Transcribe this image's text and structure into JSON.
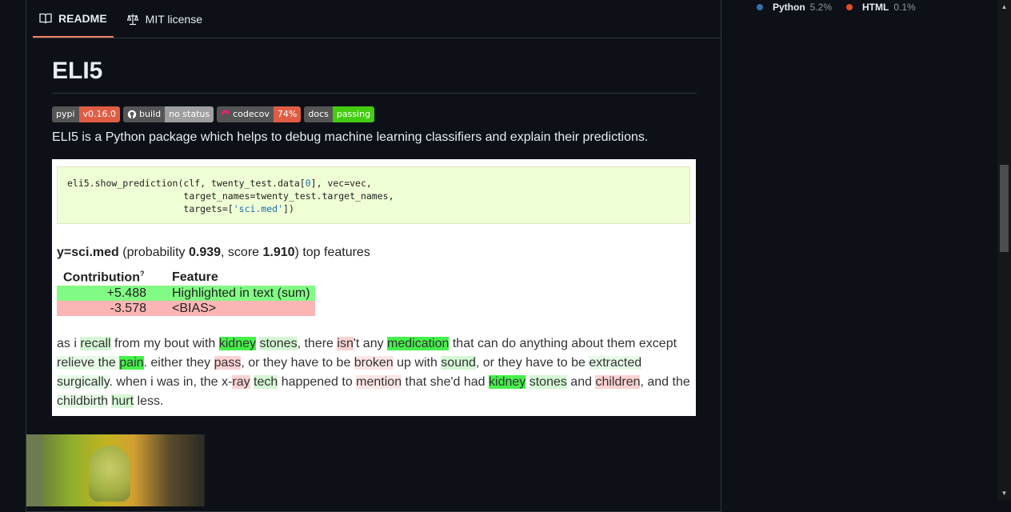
{
  "tabs": [
    {
      "label": "README",
      "icon": "book-icon"
    },
    {
      "label": "MIT license",
      "icon": "scale-icon"
    }
  ],
  "readme": {
    "title": "ELI5",
    "badges": [
      {
        "left": "pypi",
        "right": "v0.16.0",
        "color": "#e05d44"
      },
      {
        "left": "build",
        "right": "no status",
        "color": "#9f9f9f",
        "icon": "github-icon"
      },
      {
        "left": "codecov",
        "right": "74%",
        "color": "#e05d44",
        "icon": "codecov-icon"
      },
      {
        "left": "docs",
        "right": "passing",
        "color": "#4c1"
      }
    ],
    "description": "ELI5 is a Python package which helps to debug machine learning classifiers and explain their predictions.",
    "code": {
      "line1a": "eli5.show_prediction(clf, twenty_test.data[",
      "line1num": "0",
      "line1b": "], vec=vec,",
      "line2": "                     target_names=twenty_test.target_names,",
      "line3a": "                     targets=[",
      "line3str": "'sci.med'",
      "line3b": "])"
    },
    "prediction": {
      "label": "y=sci.med",
      "prob_text": " (probability ",
      "prob": "0.939",
      "score_text": ", score ",
      "score": "1.910",
      "tail": ") top features"
    },
    "table": {
      "col1": "Contribution",
      "col1_sup": "?",
      "col2": "Feature",
      "rows": [
        {
          "value": "+5.488",
          "feature": "Highlighted in text (sum)"
        },
        {
          "value": "-3.578",
          "feature": "<BIAS>"
        }
      ]
    },
    "text_tokens": [
      [
        "as i ",
        ""
      ],
      [
        "recall",
        "g2"
      ],
      [
        " from my bout with ",
        ""
      ],
      [
        "kidney",
        "g1"
      ],
      [
        " ",
        ""
      ],
      [
        "stones",
        "g2"
      ],
      [
        ", there ",
        ""
      ],
      [
        "isn",
        "r1"
      ],
      [
        "'t any ",
        ""
      ],
      [
        "medication",
        "g1"
      ],
      [
        " that can do anything about them except ",
        ""
      ],
      [
        "relieve the ",
        "g3"
      ],
      [
        "pain",
        "g1"
      ],
      [
        ". either they ",
        ""
      ],
      [
        "pass",
        "r1"
      ],
      [
        ", or they have to be ",
        ""
      ],
      [
        "broken",
        "r2"
      ],
      [
        " up with ",
        ""
      ],
      [
        "sound",
        "g2"
      ],
      [
        ", or they have to be ",
        ""
      ],
      [
        "extracted",
        "g3"
      ],
      [
        " ",
        ""
      ],
      [
        "surgically",
        "g3"
      ],
      [
        ".",
        ""
      ],
      [
        " when i was in, the x-",
        ""
      ],
      [
        "ray",
        "r1"
      ],
      [
        " ",
        ""
      ],
      [
        "tech",
        "g2"
      ],
      [
        " happened to ",
        ""
      ],
      [
        "mention",
        "r2"
      ],
      [
        " that she'd had ",
        ""
      ],
      [
        "kidney",
        "g1"
      ],
      [
        " ",
        ""
      ],
      [
        "stones",
        "g2"
      ],
      [
        " and ",
        ""
      ],
      [
        "children",
        "r1"
      ],
      [
        ", and the ",
        ""
      ],
      [
        "childbirth",
        "g3"
      ],
      [
        " ",
        ""
      ],
      [
        "hurt",
        "g2"
      ],
      [
        " less.",
        ""
      ]
    ]
  },
  "languages": [
    {
      "name": "Python",
      "pct": "5.2%",
      "color": "#3572A5"
    },
    {
      "name": "HTML",
      "pct": "0.1%",
      "color": "#e34c26"
    }
  ]
}
